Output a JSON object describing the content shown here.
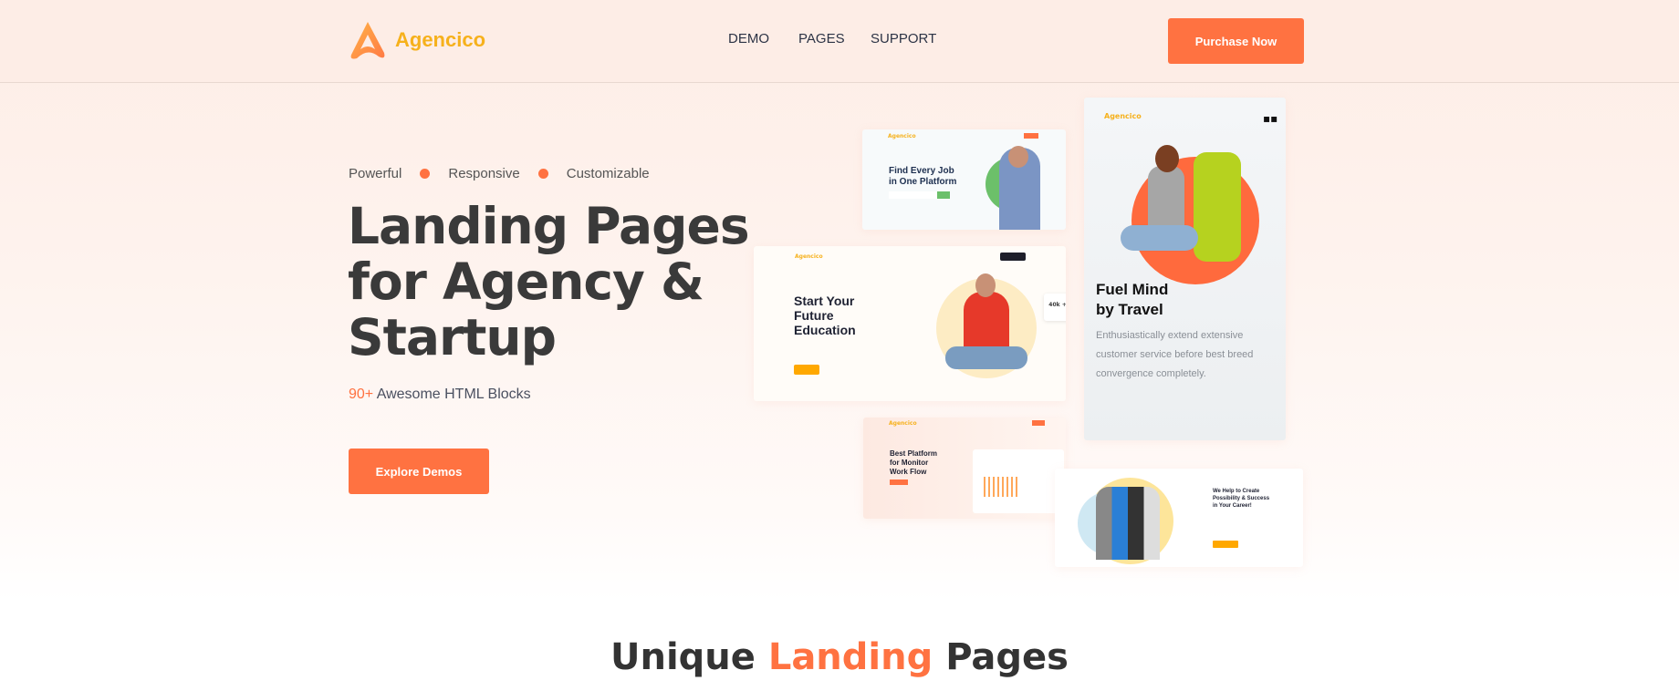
{
  "header": {
    "brand": "Agencico",
    "nav": [
      "DEMO",
      "PAGES",
      "SUPPORT"
    ],
    "purchase_label": "Purchase Now"
  },
  "hero": {
    "features": [
      "Powerful",
      "Responsive",
      "Customizable"
    ],
    "title_lines": [
      "Landing Pages",
      "for Agency &",
      "Startup"
    ],
    "blocks_count": "90+",
    "blocks_text": "Awesome HTML Blocks",
    "cta_label": "Explore Demos"
  },
  "previews": {
    "job": {
      "brand": "Agencico",
      "title_lines": [
        "Find Every Job",
        "in One Platform"
      ]
    },
    "education": {
      "brand": "Agencico",
      "title_lines": [
        "Start Your",
        "Future",
        "Education"
      ],
      "stat": "40k +"
    },
    "travel": {
      "brand": "Agencico",
      "title_lines": [
        "Fuel Mind",
        "by Travel"
      ],
      "text": "Enthusiastically extend extensive customer service before best breed convergence completely."
    },
    "monitor": {
      "brand": "Agencico",
      "title_lines": [
        "Best Platform",
        "for Monitor",
        "Work Flow"
      ]
    },
    "career": {
      "title_lines": [
        "We Help to Create",
        "Possibility & Success",
        "in Your Career!"
      ]
    }
  },
  "section": {
    "title_pre": "Unique",
    "title_hl": "Landing",
    "title_post": "Pages"
  },
  "colors": {
    "accent": "#ff7241",
    "brand": "#f6b11c",
    "text": "#3a3a3a"
  }
}
